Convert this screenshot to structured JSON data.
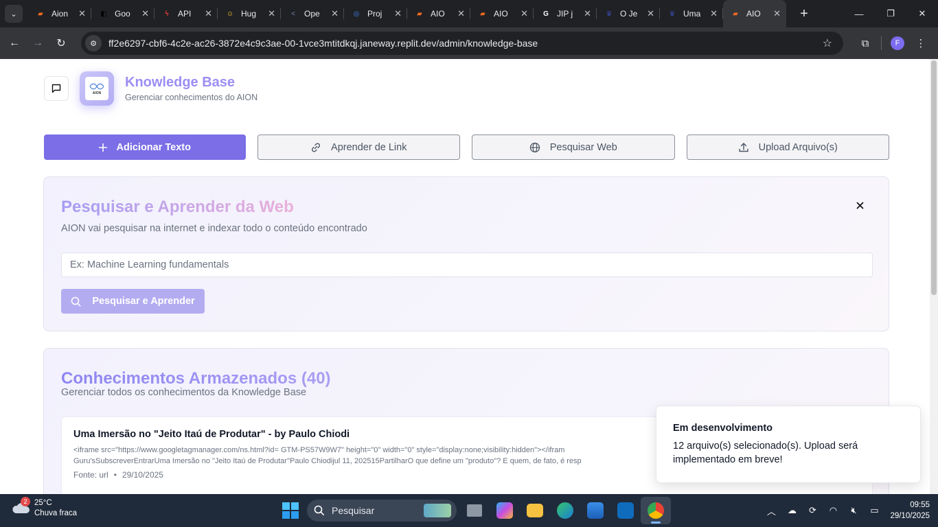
{
  "browser": {
    "tabs": [
      {
        "title": "Aion",
        "color": "#f36b21",
        "glyph": "▰"
      },
      {
        "title": "Goo",
        "color": "#000000",
        "glyph": "◧"
      },
      {
        "title": "API",
        "color": "#e53935",
        "glyph": "ϟ"
      },
      {
        "title": "Hug",
        "color": "#ffcf33",
        "glyph": "☺"
      },
      {
        "title": "Ope",
        "color": "#5f6b8a",
        "glyph": "<"
      },
      {
        "title": "Proj",
        "color": "#3b82f6",
        "glyph": "◎"
      },
      {
        "title": "AIO",
        "color": "#f36b21",
        "glyph": "▰"
      },
      {
        "title": "AIO",
        "color": "#f36b21",
        "glyph": "▰"
      },
      {
        "title": "JIP j",
        "color": "#ffffff",
        "glyph": "G"
      },
      {
        "title": "O Je",
        "color": "#3949ab",
        "glyph": "♛"
      },
      {
        "title": "Uma",
        "color": "#3949ab",
        "glyph": "♛"
      },
      {
        "title": "AIO",
        "color": "#f36b21",
        "glyph": "▰"
      }
    ],
    "url": "ff2e6297-cbf6-4c2e-ac26-3872e4c9c3ae-00-1vce3mtitdkqj.janeway.replit.dev/admin/knowledge-base",
    "profile_initial": "F"
  },
  "header": {
    "title": "Knowledge Base",
    "subtitle": "Gerenciar conhecimentos do AION",
    "logo_text": "AION"
  },
  "actions": {
    "add_text": "Adicionar Texto",
    "learn_link": "Aprender de Link",
    "search_web": "Pesquisar Web",
    "upload": "Upload Arquivo(s)"
  },
  "web_search": {
    "title": "Pesquisar e Aprender da Web",
    "subtitle": "AION vai pesquisar na internet e indexar todo o conteúdo encontrado",
    "placeholder": "Ex: Machine Learning fundamentals",
    "button": "Pesquisar e Aprender"
  },
  "stored": {
    "title": "Conhecimentos Armazenados (40)",
    "subtitle": "Gerenciar todos os conhecimentos da Knowledge Base",
    "items": [
      {
        "title": "Uma Imersão no \"Jeito Itaú de Produtar\" - by Paulo Chiodi",
        "line1": "<iframe src=\"https://www.googletagmanager.com/ns.html?id= GTM-PS57W9W7\" height=\"0\" width=\"0\" style=\"display:none;visibility:hidden\"></ifram",
        "line2": "Guru'sSubscreverEntrarUma Imersão no \"Jeito Itaú de Produtar\"Paulo Chiodijul 11, 202515PartilharO que define um \"produto\"? E quem, de fato, é resp",
        "source": "Fonte: url",
        "date": "29/10/2025"
      }
    ]
  },
  "toast": {
    "title": "Em desenvolvimento",
    "message": "12 arquivo(s) selecionado(s). Upload será implementado em breve!"
  },
  "taskbar": {
    "weather_temp": "25°C",
    "weather_desc": "Chuva fraca",
    "weather_badge": "2",
    "search_label": "Pesquisar",
    "time": "09:55",
    "date": "29/10/2025"
  }
}
